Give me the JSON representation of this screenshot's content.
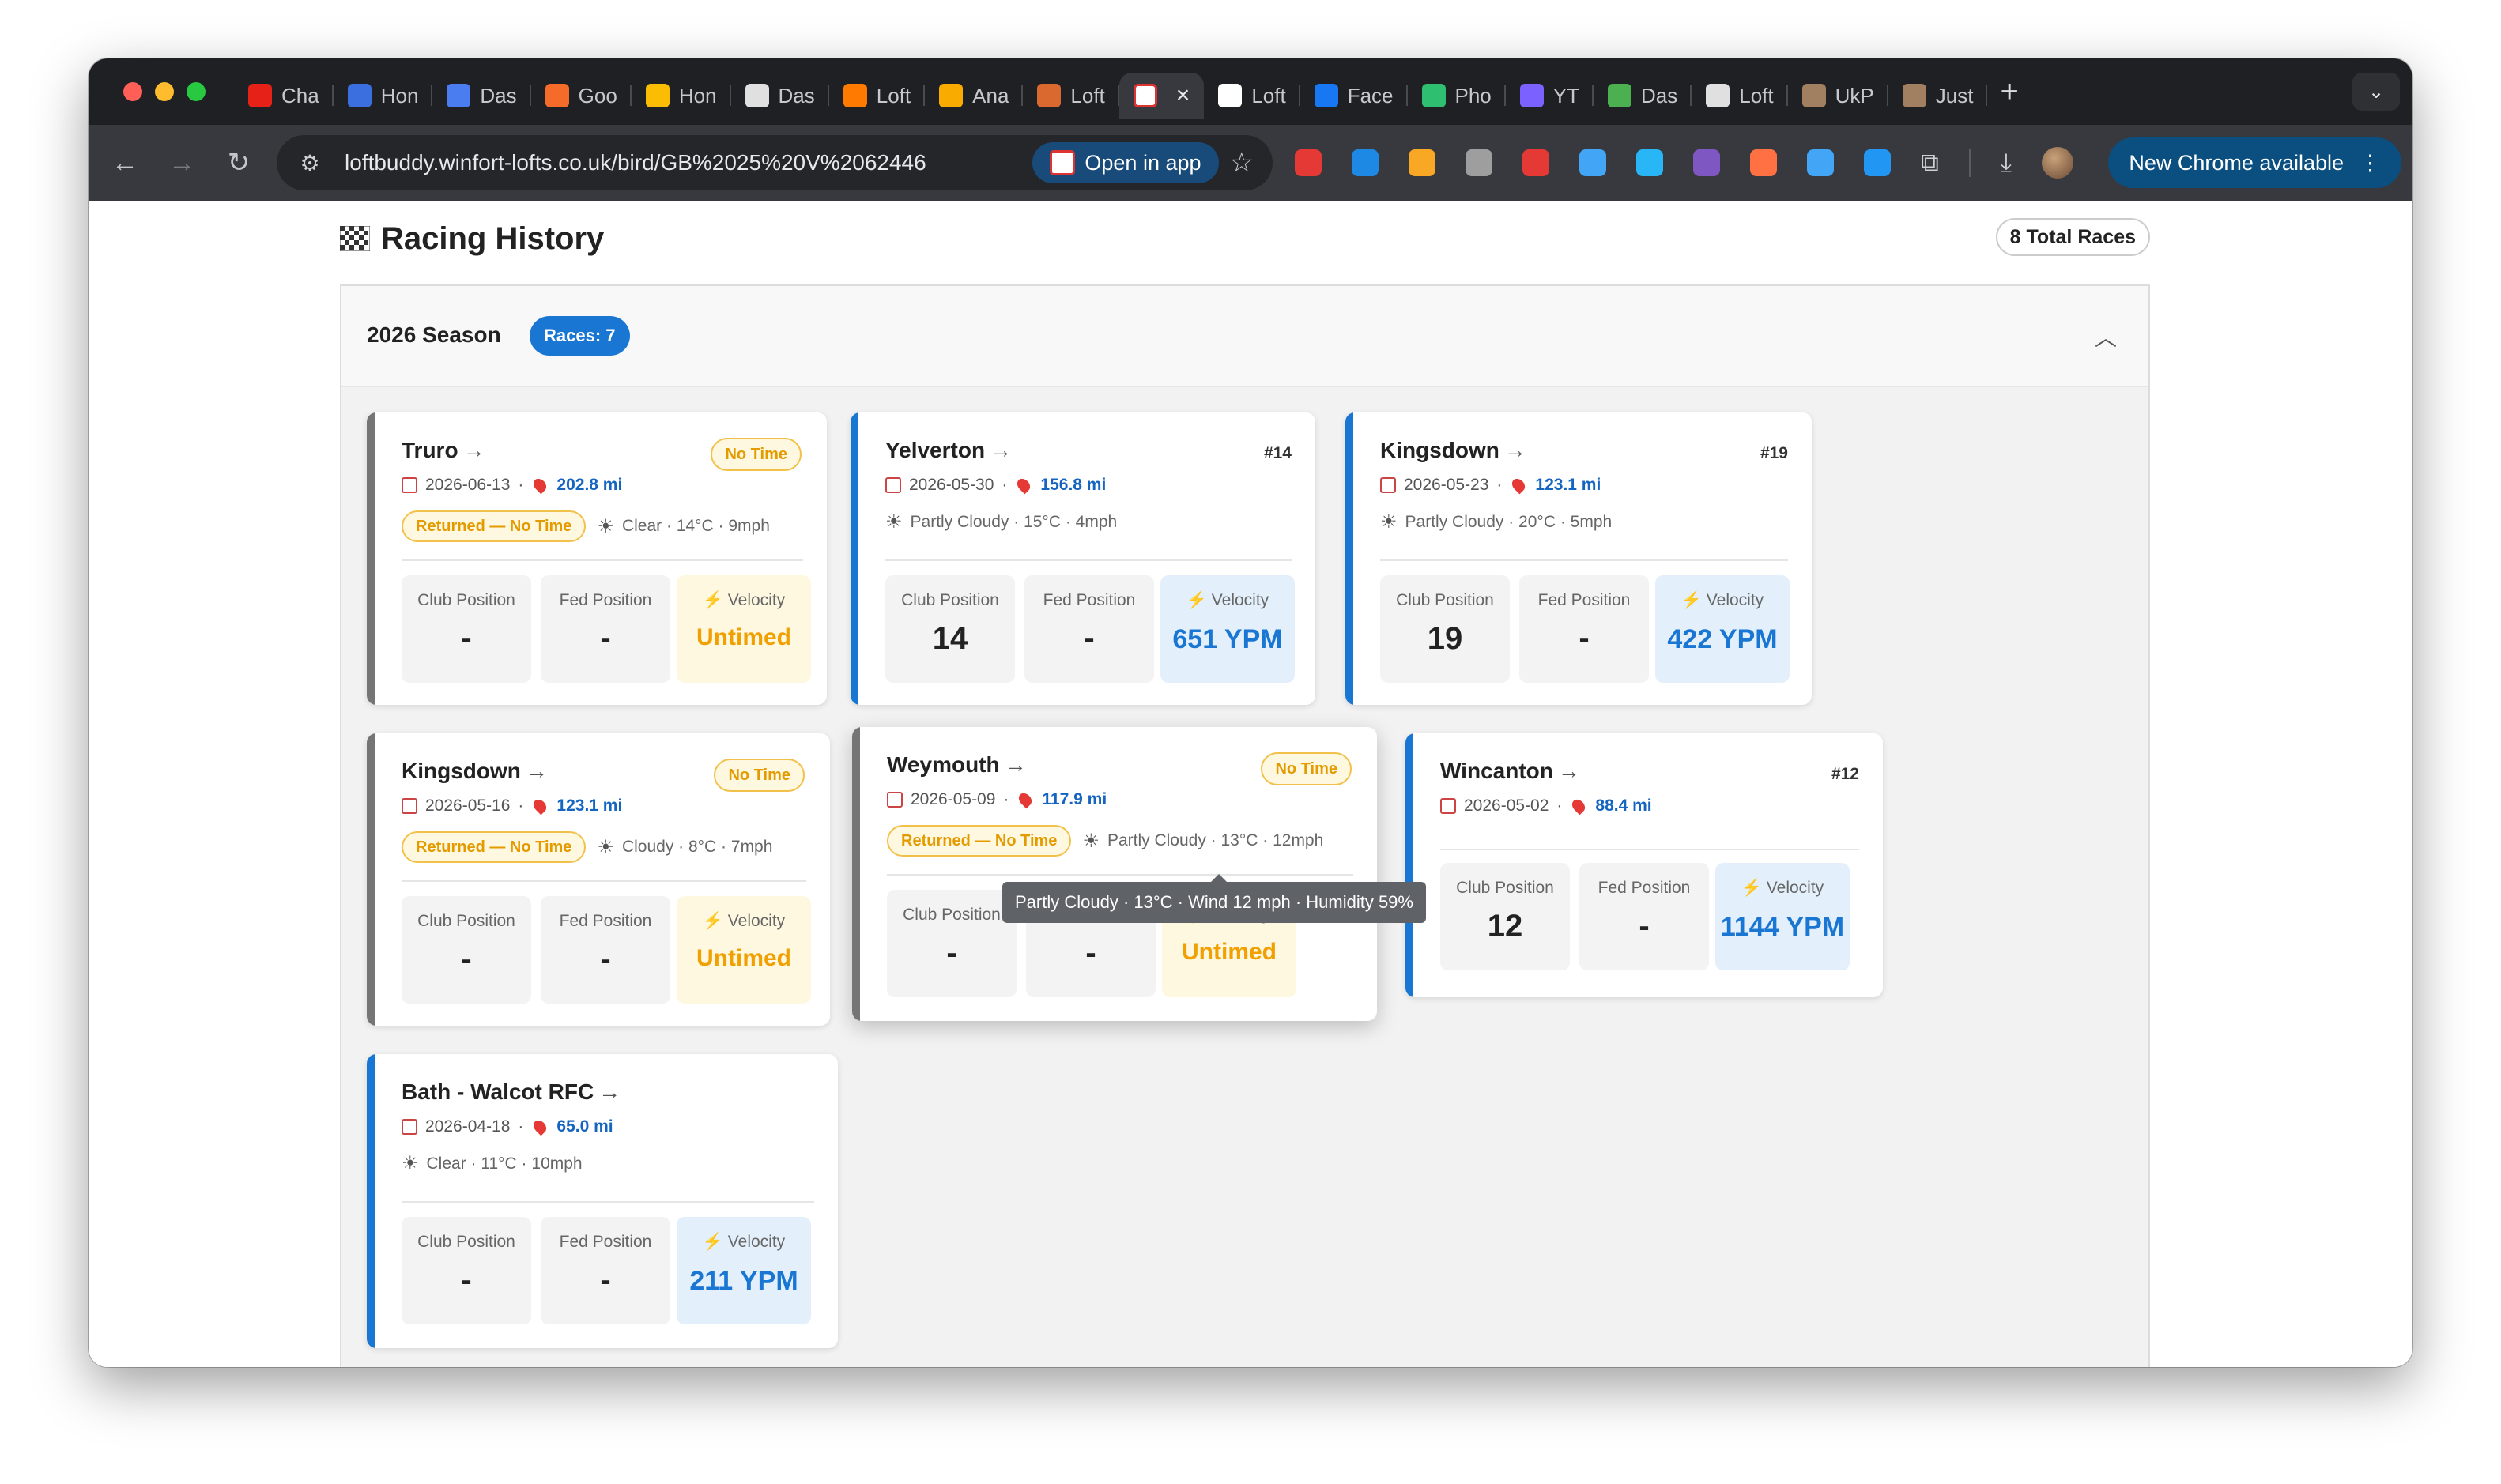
{
  "browser": {
    "tabs": [
      {
        "label": "Cha",
        "color": "#e62117"
      },
      {
        "label": "Hon",
        "color": "#3b6fe0"
      },
      {
        "label": "Das",
        "color": "#4a7df0"
      },
      {
        "label": "Goo",
        "color": "#f56b2a"
      },
      {
        "label": "Hon",
        "color": "#fbbc04"
      },
      {
        "label": "Das",
        "color": "#e0e0e0"
      },
      {
        "label": "Loft",
        "color": "#ff7a00"
      },
      {
        "label": "Ana",
        "color": "#f9ab00"
      },
      {
        "label": "Loft",
        "color": "#d9692f"
      },
      {
        "label": "",
        "color": "#ffffff",
        "active": true
      },
      {
        "label": "Loft",
        "color": "#ffffff"
      },
      {
        "label": "Face",
        "color": "#1877f2"
      },
      {
        "label": "Pho",
        "color": "#2fbf71"
      },
      {
        "label": "YT",
        "color": "#7b61ff"
      },
      {
        "label": "Das",
        "color": "#4caf50"
      },
      {
        "label": "Loft",
        "color": "#e0e0e0"
      },
      {
        "label": "UkP",
        "color": "#a08060"
      },
      {
        "label": "Just",
        "color": "#a08060"
      }
    ],
    "url": "loftbuddy.winfort-lofts.co.uk/bird/GB%2025%20V%2062446",
    "open_in_app": "Open in app",
    "new_chrome": "New Chrome available",
    "extensions": [
      "#e53935",
      "#1e88e5",
      "#f9a825",
      "#9e9e9e",
      "#e53935",
      "#42a5f5",
      "#29b6f6",
      "#7e57c2",
      "#ff7043",
      "#42a5f5",
      "#2196f3"
    ]
  },
  "page": {
    "title": "Racing History",
    "total_races": "8 Total Races",
    "season": {
      "title": "2026 Season",
      "badge": "Races: 7"
    },
    "labels": {
      "club": "Club Position",
      "fed": "Fed Position",
      "velocity": "Velocity",
      "no_time": "No Time",
      "returned": "Returned — No Time",
      "arrow": "→"
    },
    "races": [
      {
        "name": "Truro",
        "date": "2026-06-13",
        "distance": "202.8 mi",
        "weather": "Clear · 14°C · 9mph",
        "status": "No Time",
        "club": "-",
        "fed": "-",
        "velocity": "Untimed"
      },
      {
        "name": "Yelverton",
        "date": "2026-05-30",
        "distance": "156.8 mi",
        "weather": "Partly Cloudy · 15°C · 4mph",
        "rank": "#14",
        "club": "14",
        "fed": "-",
        "velocity": "651 YPM"
      },
      {
        "name": "Kingsdown",
        "date": "2026-05-23",
        "distance": "123.1 mi",
        "weather": "Partly Cloudy · 20°C · 5mph",
        "rank": "#19",
        "club": "19",
        "fed": "-",
        "velocity": "422 YPM"
      },
      {
        "name": "Kingsdown",
        "date": "2026-05-16",
        "distance": "123.1 mi",
        "weather": "Cloudy · 8°C · 7mph",
        "status": "No Time",
        "club": "-",
        "fed": "-",
        "velocity": "Untimed"
      },
      {
        "name": "Weymouth",
        "date": "2026-05-09",
        "distance": "117.9 mi",
        "weather": "Partly Cloudy · 13°C · 12mph",
        "status": "No Time",
        "club": "-",
        "fed": "-",
        "velocity": "Untimed",
        "tooltip": "Partly Cloudy · 13°C · Wind 12 mph · Humidity 59%"
      },
      {
        "name": "Wincanton",
        "date": "2026-05-02",
        "distance": "88.4 mi",
        "rank": "#12",
        "club": "12",
        "fed": "-",
        "velocity": "1144 YPM"
      },
      {
        "name": "Bath - Walcot RFC",
        "date": "2026-04-18",
        "distance": "65.0 mi",
        "weather": "Clear · 11°C · 10mph",
        "club": "-",
        "fed": "-",
        "velocity": "211 YPM"
      }
    ]
  }
}
